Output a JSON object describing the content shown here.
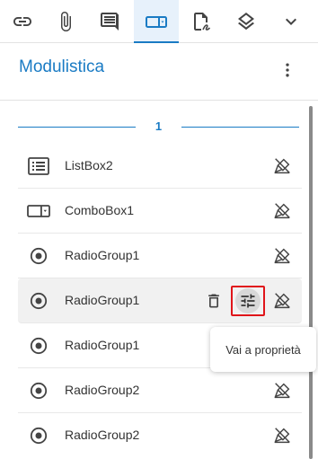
{
  "toolbar": {
    "items": [
      {
        "icon": "link-icon"
      },
      {
        "icon": "paperclip-icon"
      },
      {
        "icon": "comment-icon"
      },
      {
        "icon": "form-field-icon",
        "active": true
      },
      {
        "icon": "sign-document-icon"
      },
      {
        "icon": "layers-icon"
      },
      {
        "icon": "chevron-down-icon"
      }
    ]
  },
  "panel": {
    "title": "Modulistica",
    "page_number": "1"
  },
  "fields": [
    {
      "label": "ListBox2",
      "type": "listbox"
    },
    {
      "label": "ComboBox1",
      "type": "combobox"
    },
    {
      "label": "RadioGroup1",
      "type": "radio"
    },
    {
      "label": "RadioGroup1",
      "type": "radio",
      "hovered": true
    },
    {
      "label": "RadioGroup1",
      "type": "radio"
    },
    {
      "label": "RadioGroup2",
      "type": "radio"
    },
    {
      "label": "RadioGroup2",
      "type": "radio"
    }
  ],
  "tooltip": {
    "text": "Vai a proprietà"
  },
  "colors": {
    "accent": "#1a7bc4",
    "highlight_border": "#e0151a"
  }
}
